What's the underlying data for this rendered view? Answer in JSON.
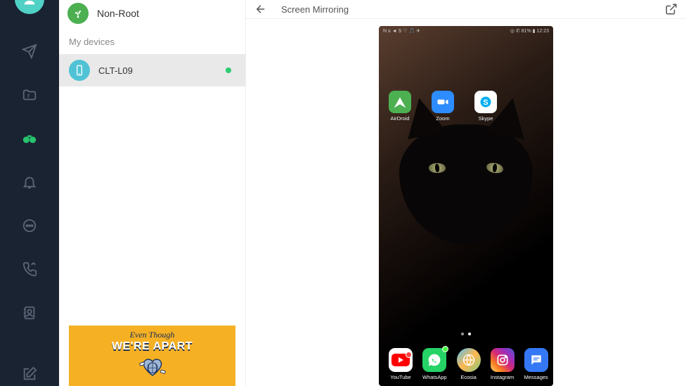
{
  "nav": {
    "avatar": "",
    "items": [
      "send",
      "files",
      "binoculars",
      "bell",
      "chat",
      "phone",
      "contacts",
      "compose"
    ]
  },
  "mode": {
    "label": "Non-Root"
  },
  "side": {
    "header": "My devices"
  },
  "device": {
    "name": "CLT-L09",
    "online": true
  },
  "ad": {
    "line1": "Even Though",
    "line2": "WE'RE APART"
  },
  "main": {
    "title": "Screen Mirroring"
  },
  "phone": {
    "status_left": "N ≤ ◄ S ♡ 🎵 ✈",
    "status_right": "◎ ✆ 81% ▮ 12:23",
    "top_apps": [
      {
        "id": "airdroid",
        "label": "AirDroid"
      },
      {
        "id": "zoom",
        "label": "Zoom"
      },
      {
        "id": "skype",
        "label": "Skype"
      }
    ],
    "bottom_apps": [
      {
        "id": "youtube",
        "label": "YouTube"
      },
      {
        "id": "whatsapp",
        "label": "WhatsApp"
      },
      {
        "id": "ecosia",
        "label": "Ecosia"
      },
      {
        "id": "instagram",
        "label": "Instagram"
      },
      {
        "id": "messages",
        "label": "Messages"
      }
    ]
  }
}
